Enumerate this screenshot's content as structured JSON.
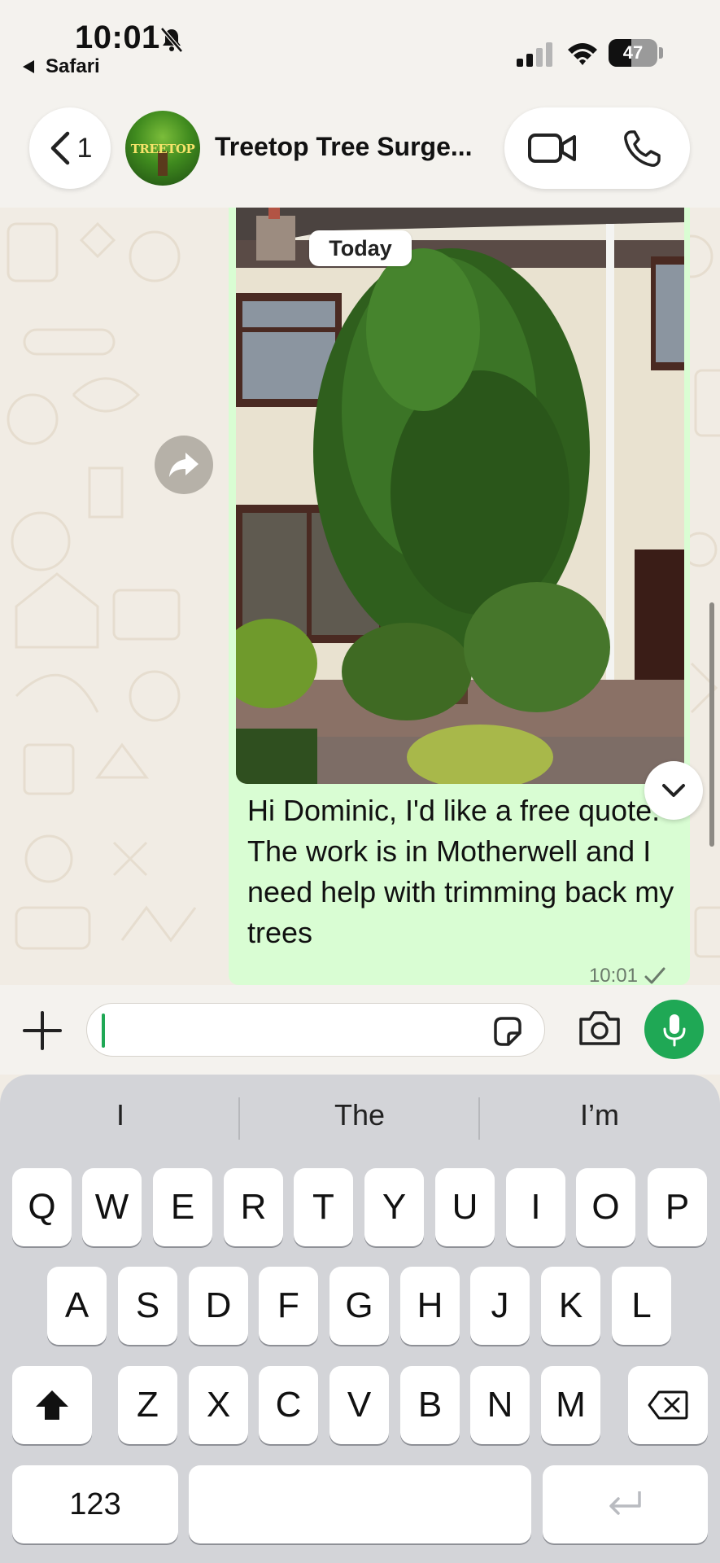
{
  "status_bar": {
    "time": "10:01",
    "back_app": "Safari",
    "battery": "47",
    "battery_level": 0.47
  },
  "header": {
    "back_count": "1",
    "contact_name": "Treetop Tree Surge...",
    "avatar_text": "TREETOP"
  },
  "chat": {
    "date_chip": "Today",
    "message": {
      "text": "Hi Dominic, I'd like a free quote. The work is in Motherwell and I need help with trimming back my trees",
      "time": "10:01"
    }
  },
  "composer": {
    "placeholder": ""
  },
  "keyboard": {
    "suggestions": [
      "I",
      "The",
      "I’m"
    ],
    "row1": [
      "Q",
      "W",
      "E",
      "R",
      "T",
      "Y",
      "U",
      "I",
      "O",
      "P"
    ],
    "row2": [
      "A",
      "S",
      "D",
      "F",
      "G",
      "H",
      "J",
      "K",
      "L"
    ],
    "row3": [
      "Z",
      "X",
      "C",
      "V",
      "B",
      "N",
      "M"
    ],
    "numbers_label": "123"
  },
  "colors": {
    "accent_green": "#1fa855",
    "bubble_green": "#d9fdd3",
    "chat_background": "#f1ece4"
  }
}
